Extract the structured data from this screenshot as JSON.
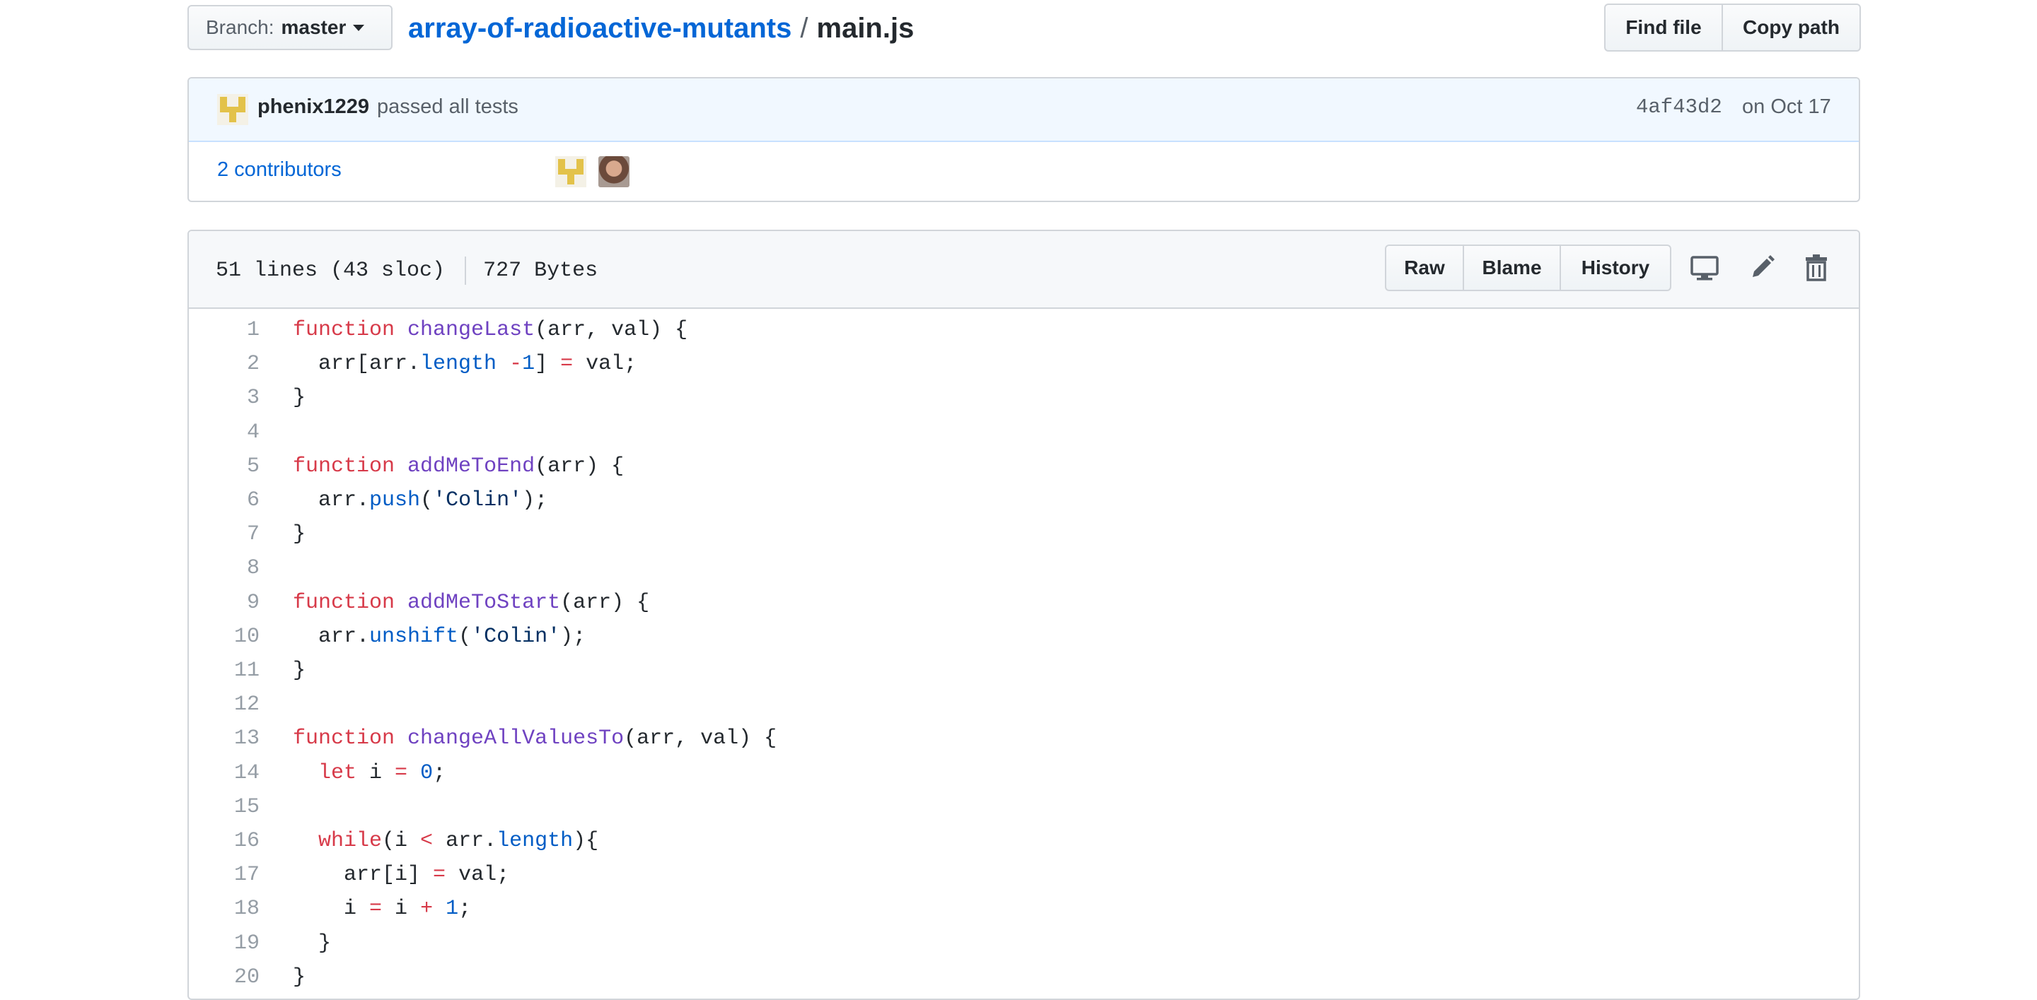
{
  "header": {
    "branch_label": "Branch:",
    "branch_value": "master",
    "repo_name": "array-of-radioactive-mutants",
    "separator": "/",
    "file_name": "main.js",
    "find_file_label": "Find file",
    "copy_path_label": "Copy path"
  },
  "commit": {
    "author": "phenix1229",
    "message": "passed all tests",
    "sha": "4af43d2",
    "date": "on Oct 17",
    "contributors_label": "2 contributors"
  },
  "file": {
    "lines_info": "51 lines (43 sloc)",
    "size_info": "727 Bytes",
    "raw_label": "Raw",
    "blame_label": "Blame",
    "history_label": "History",
    "icons": [
      "desktop-icon",
      "pencil-icon",
      "trash-icon"
    ]
  },
  "code": [
    {
      "num": "1",
      "tokens": [
        {
          "t": "function",
          "c": "kw"
        },
        {
          "t": " "
        },
        {
          "t": "changeLast",
          "c": "fn"
        },
        {
          "t": "(arr, val) {"
        }
      ]
    },
    {
      "num": "2",
      "tokens": [
        {
          "t": "  arr[arr."
        },
        {
          "t": "length",
          "c": "pr"
        },
        {
          "t": " "
        },
        {
          "t": "-",
          "c": "kw"
        },
        {
          "t": "1",
          "c": "pr"
        },
        {
          "t": "] "
        },
        {
          "t": "=",
          "c": "kw"
        },
        {
          "t": " val;"
        }
      ]
    },
    {
      "num": "3",
      "tokens": [
        {
          "t": "}"
        }
      ]
    },
    {
      "num": "4",
      "tokens": []
    },
    {
      "num": "5",
      "tokens": [
        {
          "t": "function",
          "c": "kw"
        },
        {
          "t": " "
        },
        {
          "t": "addMeToEnd",
          "c": "fn"
        },
        {
          "t": "(arr) {"
        }
      ]
    },
    {
      "num": "6",
      "tokens": [
        {
          "t": "  arr."
        },
        {
          "t": "push",
          "c": "pr"
        },
        {
          "t": "("
        },
        {
          "t": "'Colin'",
          "c": "st"
        },
        {
          "t": ");"
        }
      ]
    },
    {
      "num": "7",
      "tokens": [
        {
          "t": "}"
        }
      ]
    },
    {
      "num": "8",
      "tokens": []
    },
    {
      "num": "9",
      "tokens": [
        {
          "t": "function",
          "c": "kw"
        },
        {
          "t": " "
        },
        {
          "t": "addMeToStart",
          "c": "fn"
        },
        {
          "t": "(arr) {"
        }
      ]
    },
    {
      "num": "10",
      "tokens": [
        {
          "t": "  arr."
        },
        {
          "t": "unshift",
          "c": "pr"
        },
        {
          "t": "("
        },
        {
          "t": "'Colin'",
          "c": "st"
        },
        {
          "t": ");"
        }
      ]
    },
    {
      "num": "11",
      "tokens": [
        {
          "t": "}"
        }
      ]
    },
    {
      "num": "12",
      "tokens": []
    },
    {
      "num": "13",
      "tokens": [
        {
          "t": "function",
          "c": "kw"
        },
        {
          "t": " "
        },
        {
          "t": "changeAllValuesTo",
          "c": "fn"
        },
        {
          "t": "(arr, val) {"
        }
      ]
    },
    {
      "num": "14",
      "tokens": [
        {
          "t": "  "
        },
        {
          "t": "let",
          "c": "kw"
        },
        {
          "t": " i "
        },
        {
          "t": "=",
          "c": "kw"
        },
        {
          "t": " "
        },
        {
          "t": "0",
          "c": "pr"
        },
        {
          "t": ";"
        }
      ]
    },
    {
      "num": "15",
      "tokens": []
    },
    {
      "num": "16",
      "tokens": [
        {
          "t": "  "
        },
        {
          "t": "while",
          "c": "kw"
        },
        {
          "t": "(i "
        },
        {
          "t": "<",
          "c": "kw"
        },
        {
          "t": " arr."
        },
        {
          "t": "length",
          "c": "pr"
        },
        {
          "t": "){"
        }
      ]
    },
    {
      "num": "17",
      "tokens": [
        {
          "t": "    arr[i] "
        },
        {
          "t": "=",
          "c": "kw"
        },
        {
          "t": " val;"
        }
      ]
    },
    {
      "num": "18",
      "tokens": [
        {
          "t": "    i "
        },
        {
          "t": "=",
          "c": "kw"
        },
        {
          "t": " i "
        },
        {
          "t": "+",
          "c": "kw"
        },
        {
          "t": " "
        },
        {
          "t": "1",
          "c": "pr"
        },
        {
          "t": ";"
        }
      ]
    },
    {
      "num": "19",
      "tokens": [
        {
          "t": "  }"
        }
      ]
    },
    {
      "num": "20",
      "tokens": [
        {
          "t": "}"
        }
      ]
    }
  ]
}
